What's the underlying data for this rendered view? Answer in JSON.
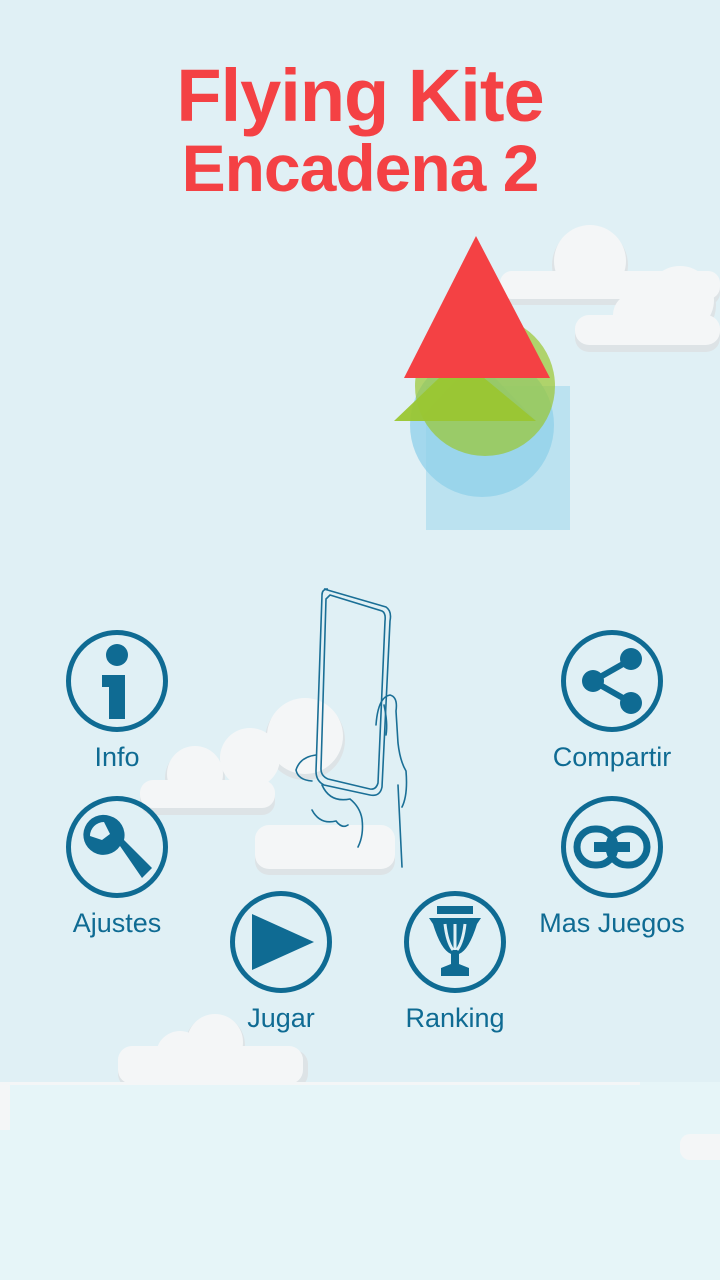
{
  "title": {
    "line1": "Flying Kite",
    "line2": "Encadena 2"
  },
  "colors": {
    "background": "#e0f0f5",
    "title": "#f44144",
    "button": "#0f6b93",
    "kite_red": "#f44144",
    "kite_green": "#9ac631",
    "kite_blue": "#8fd0ea"
  },
  "menu": {
    "info": {
      "label": "Info",
      "icon": "info-icon"
    },
    "share": {
      "label": "Compartir",
      "icon": "share-icon"
    },
    "settings": {
      "label": "Ajustes",
      "icon": "wrench-icon"
    },
    "more_games": {
      "label": "Mas Juegos",
      "icon": "chain-link-icon"
    },
    "play": {
      "label": "Jugar",
      "icon": "play-icon"
    },
    "ranking": {
      "label": "Ranking",
      "icon": "trophy-icon"
    }
  }
}
